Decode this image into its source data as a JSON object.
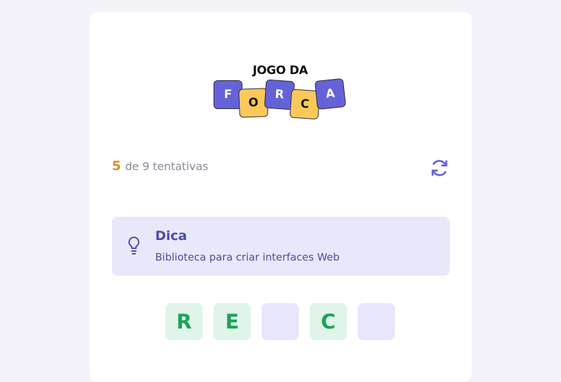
{
  "logo": {
    "title": "JOGO DA",
    "letters": [
      "F",
      "O",
      "R",
      "C",
      "A"
    ]
  },
  "status": {
    "attempts_used": "5",
    "attempts_text": "de 9 tentativas",
    "reset_icon": "refresh-icon"
  },
  "hint": {
    "icon": "lightbulb-icon",
    "title": "Dica",
    "text": "Biblioteca para criar interfaces Web"
  },
  "word": {
    "slots": [
      "R",
      "E",
      "",
      "C",
      ""
    ]
  },
  "colors": {
    "background": "#f4f3fa",
    "card": "#ffffff",
    "accent_purple": "#6562d8",
    "accent_yellow": "#fbc85a",
    "attempts_count": "#e0892a",
    "hint_bg": "#e9e8fb",
    "hint_text": "#4c4aa8",
    "correct_letter": "#1aa457",
    "slot_filled_bg": "#e0f4ea",
    "slot_empty_bg": "#e7e6fb"
  }
}
